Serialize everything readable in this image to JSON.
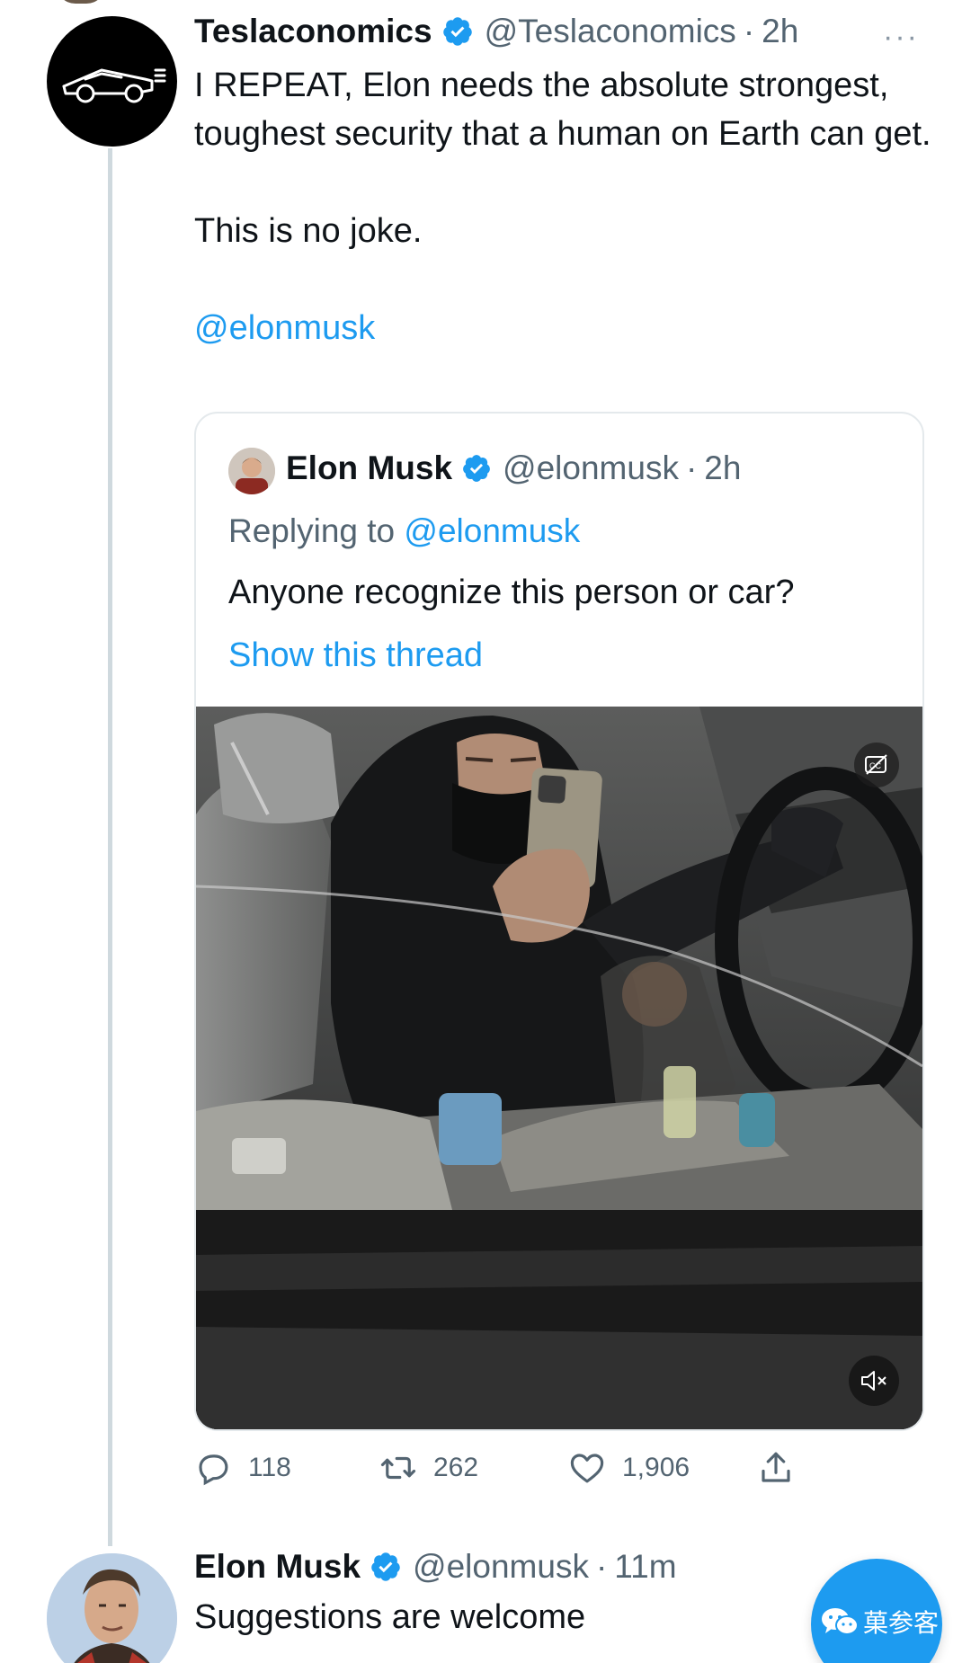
{
  "tweet1": {
    "name": "Teslaconomics",
    "handle": "@Teslaconomics",
    "dot": "·",
    "time": "2h",
    "more": "···",
    "text_line1": "I REPEAT, Elon needs the absolute strongest, toughest security that a human on Earth can get.",
    "text_line2": "This is no joke.",
    "mention": "@elonmusk",
    "replies": "118",
    "retweets": "262",
    "likes": "1,906"
  },
  "quoted": {
    "name": "Elon Musk",
    "handle": "@elonmusk",
    "dot": "·",
    "time": "2h",
    "replying_prefix": "Replying to ",
    "replying_handle": "@elonmusk",
    "text": "Anyone recognize this person or car?",
    "show_thread": "Show this thread"
  },
  "tweet2": {
    "name": "Elon Musk",
    "handle": "@elonmusk",
    "dot": "·",
    "time": "11m",
    "text": "Suggestions are welcome"
  },
  "badge": {
    "label": "菓参客"
  },
  "icons": {
    "verified": "verified-badge-icon",
    "reply": "reply-icon",
    "retweet": "retweet-icon",
    "like": "heart-icon",
    "share": "share-icon",
    "captions": "captions-off-icon",
    "mute": "volume-muted-icon",
    "wechat": "wechat-icon"
  },
  "colors": {
    "accent": "#1d9bf0",
    "text": "#0f1419",
    "secondary": "#536471",
    "border": "#e4e9ec"
  }
}
